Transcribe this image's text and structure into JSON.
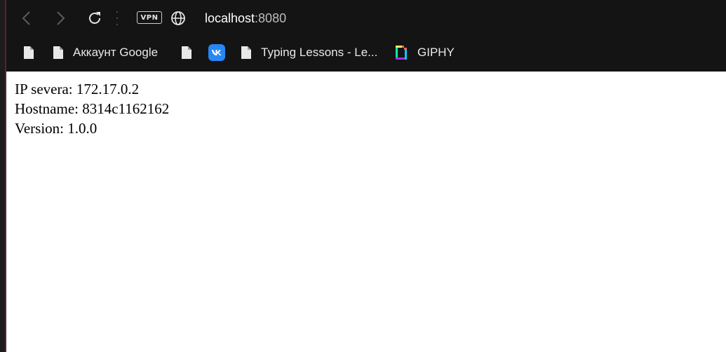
{
  "browser": {
    "vpn_label": "VPN",
    "address": {
      "host": "localhost",
      "port": ":8080"
    }
  },
  "bookmarks": [
    {
      "label": "",
      "icon": "page-icon"
    },
    {
      "label": "Аккаунт Google",
      "icon": "page-icon"
    },
    {
      "label": "",
      "icon": "page-icon"
    },
    {
      "label": "",
      "icon": "vk-icon"
    },
    {
      "label": "Typing Lessons - Le...",
      "icon": "page-icon"
    },
    {
      "label": "GIPHY",
      "icon": "giphy-icon"
    }
  ],
  "page": {
    "lines": [
      "IP severa: 172.17.0.2",
      "Hostname: 8314c1162162",
      "Version: 1.0.0"
    ]
  },
  "colors": {
    "chrome_bg": "#141414",
    "page_bg": "#ffffff",
    "vk_blue": "#2787f5",
    "text": "#000000"
  }
}
